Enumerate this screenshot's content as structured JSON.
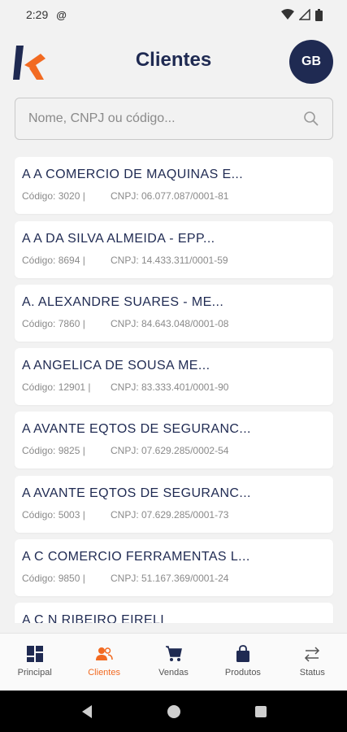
{
  "status_bar": {
    "time": "2:29"
  },
  "header": {
    "title": "Clientes",
    "avatar_initials": "GB"
  },
  "search": {
    "placeholder": "Nome, CNPJ ou código..."
  },
  "clients": [
    {
      "name": "A A COMERCIO DE MAQUINAS E...",
      "code": "Código: 3020 |",
      "cnpj": "CNPJ: 06.077.087/0001-81"
    },
    {
      "name": "A A DA SILVA ALMEIDA - EPP...",
      "code": "Código: 8694 |",
      "cnpj": "CNPJ: 14.433.311/0001-59"
    },
    {
      "name": "A. ALEXANDRE SUARES - ME...",
      "code": "Código: 7860 |",
      "cnpj": "CNPJ: 84.643.048/0001-08"
    },
    {
      "name": "A ANGELICA DE SOUSA ME...",
      "code": "Código: 12901 |",
      "cnpj": "CNPJ: 83.333.401/0001-90"
    },
    {
      "name": "A AVANTE EQTOS DE SEGURANC...",
      "code": "Código: 9825 |",
      "cnpj": "CNPJ: 07.629.285/0002-54"
    },
    {
      "name": "A AVANTE EQTOS DE SEGURANC...",
      "code": "Código: 5003 |",
      "cnpj": "CNPJ: 07.629.285/0001-73"
    },
    {
      "name": "A C COMERCIO FERRAMENTAS L...",
      "code": "Código: 9850 |",
      "cnpj": "CNPJ: 51.167.369/0001-24"
    },
    {
      "name": "A C N RIBEIRO EIRELI",
      "code": "",
      "cnpj": ""
    }
  ],
  "bottom_nav": {
    "items": [
      {
        "label": "Principal",
        "icon": "dashboard-icon"
      },
      {
        "label": "Clientes",
        "icon": "people-icon"
      },
      {
        "label": "Vendas",
        "icon": "cart-icon"
      },
      {
        "label": "Produtos",
        "icon": "bag-icon"
      },
      {
        "label": "Status",
        "icon": "sync-arrows-icon"
      }
    ],
    "active": "Clientes"
  },
  "colors": {
    "primary": "#1f2a52",
    "accent": "#f26a21",
    "background": "#f2f2f2"
  }
}
